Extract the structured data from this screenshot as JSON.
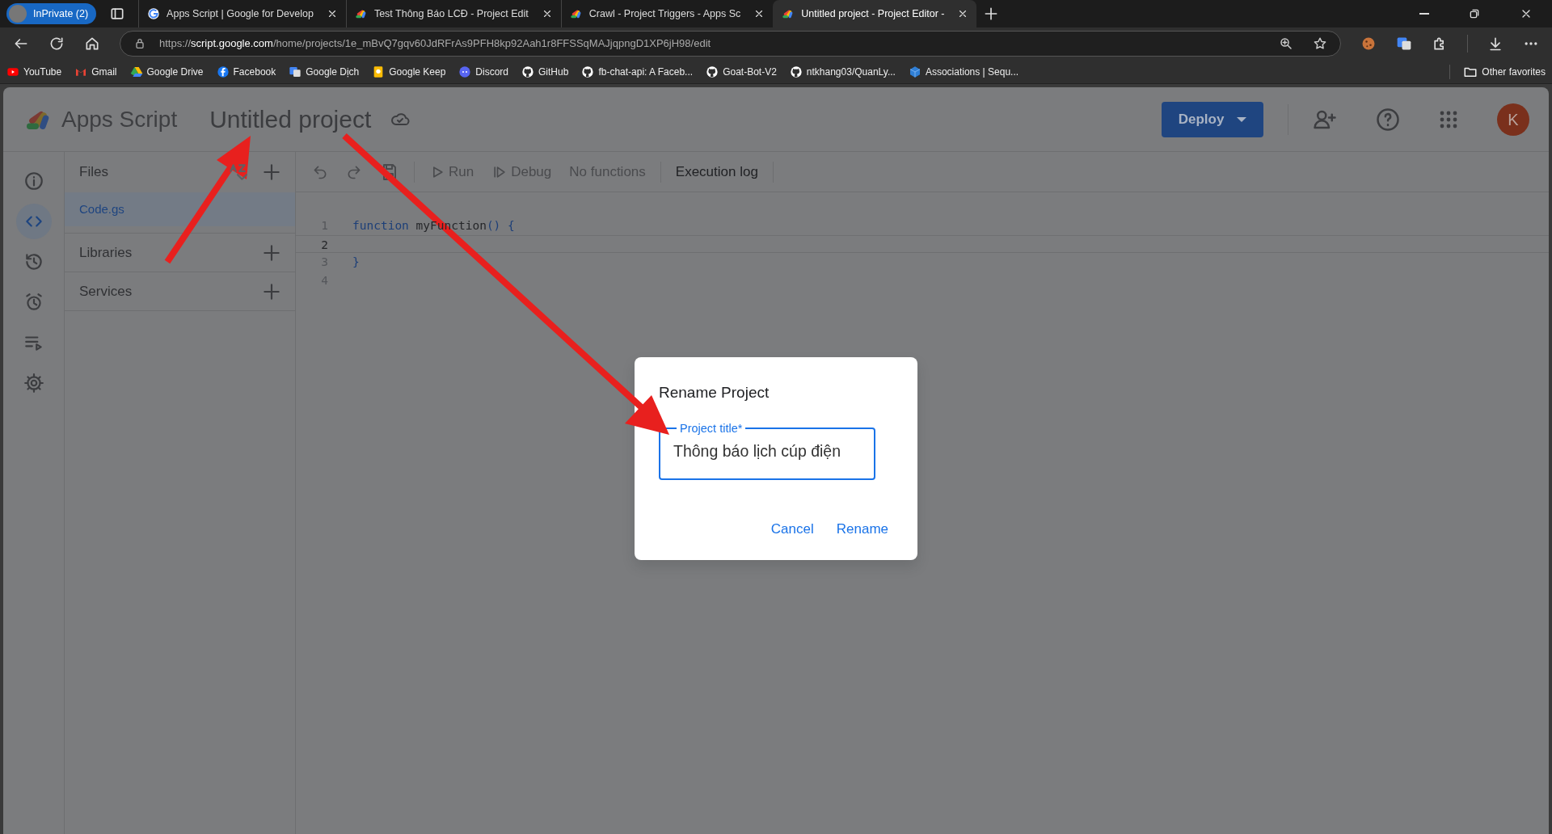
{
  "browser": {
    "profile": "InPrivate (2)",
    "tabs": [
      {
        "title": "Apps Script  |  Google for Develop",
        "kind": "google",
        "selected": false
      },
      {
        "title": "Test Thông Báo LCĐ - Project Edit",
        "kind": "appsscript",
        "selected": false
      },
      {
        "title": "Crawl - Project Triggers - Apps Sc",
        "kind": "appsscript",
        "selected": false
      },
      {
        "title": "Untitled project - Project Editor -",
        "kind": "appsscript",
        "selected": true
      }
    ],
    "url": {
      "scheme": "https://",
      "host": "script.google.com",
      "path": "/home/projects/1e_mBvQ7gqv60JdRFrAs9PFH8kp92Aah1r8FFSSqMAJjqpngD1XP6jH98/edit"
    },
    "bookmarks": [
      {
        "label": "YouTube",
        "kind": "youtube"
      },
      {
        "label": "Gmail",
        "kind": "gmail"
      },
      {
        "label": "Google Drive",
        "kind": "drive"
      },
      {
        "label": "Facebook",
        "kind": "facebook"
      },
      {
        "label": "Google Dịch",
        "kind": "translate"
      },
      {
        "label": "Google Keep",
        "kind": "keep"
      },
      {
        "label": "Discord",
        "kind": "discord"
      },
      {
        "label": "GitHub",
        "kind": "github"
      },
      {
        "label": "fb-chat-api: A Faceb...",
        "kind": "github"
      },
      {
        "label": "Goat-Bot-V2",
        "kind": "github"
      },
      {
        "label": "ntkhang03/QuanLy...",
        "kind": "github"
      },
      {
        "label": "Associations | Sequ...",
        "kind": "cube"
      }
    ],
    "other_favorites": "Other favorites"
  },
  "app": {
    "product": "Apps Script",
    "project_title": "Untitled project",
    "deploy": "Deploy",
    "avatar": "K",
    "nav": [
      {
        "kind": "info",
        "selected": false
      },
      {
        "kind": "code",
        "selected": true
      },
      {
        "kind": "history",
        "selected": false
      },
      {
        "kind": "alarm",
        "selected": false
      },
      {
        "kind": "executions",
        "selected": false
      },
      {
        "kind": "gear",
        "selected": false
      }
    ],
    "files_header": "Files",
    "files": [
      {
        "name": "Code.gs",
        "selected": true
      }
    ],
    "sections": [
      "Libraries",
      "Services"
    ],
    "toolbar": [
      {
        "kind": "undo",
        "disabled": true
      },
      {
        "kind": "redo",
        "disabled": true
      },
      {
        "kind": "save",
        "disabled": true
      },
      {
        "kind": "run",
        "label": "Run",
        "disabled": true
      },
      {
        "kind": "debug",
        "label": "Debug",
        "disabled": true
      },
      {
        "kind": "functions",
        "label": "No functions",
        "disabled": true
      },
      {
        "kind": "log",
        "label": "Execution log",
        "disabled": false
      }
    ],
    "code": [
      {
        "number": "1",
        "active": false,
        "tokens": [
          {
            "kind": "keyword",
            "text": "function"
          },
          {
            "kind": "plain",
            "text": " myFunction"
          },
          {
            "kind": "punct",
            "text": "() {"
          }
        ]
      },
      {
        "number": "2",
        "active": true
      },
      {
        "number": "3",
        "active": false,
        "tokens": [
          {
            "kind": "punct",
            "text": "}"
          }
        ]
      },
      {
        "number": "4",
        "active": false
      }
    ]
  },
  "dialog": {
    "title": "Rename Project",
    "field": {
      "label": "Project title*",
      "value": "Thông báo lịch cúp điện"
    },
    "buttons": [
      {
        "label": "Cancel"
      },
      {
        "label": "Rename"
      }
    ]
  }
}
